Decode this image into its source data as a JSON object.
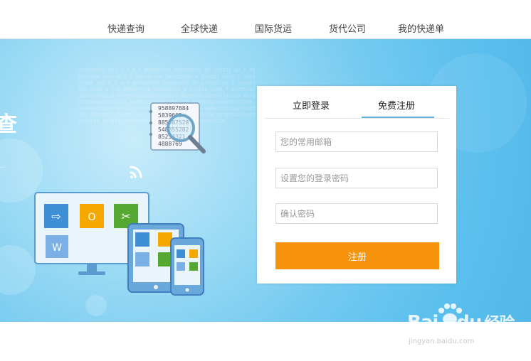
{
  "nav": {
    "items": [
      {
        "label": "快递查询"
      },
      {
        "label": "全球快递"
      },
      {
        "label": "国际货运"
      },
      {
        "label": "货代公司"
      },
      {
        "label": "我的快递单"
      }
    ]
  },
  "hero": {
    "title_fragment": "查",
    "subtitle_fragment": "..",
    "background_numbers": "958897884 583 6 5 8 9 885987528 548855282 85 233321 48 1 958897884 5839 8 7 5 885987528 548855282 8 233321 4888 7 958897884 583 6 5 8 9 885987528 548855282 85 233321 48 1 958897884 5839 8 7 5 885987528 548855282 8 233321 4888 7 98765432109876543210 98765432109876543210 98765432109876543210 98765432109876543210 98765432109876543210 98765432109876543210 98765432109876543210 98765432109876543210 98765432109876543210 98765432109876543210 98765432109876543210 98765432109876543210 98765432109876543210 98765432109876543210",
    "paper_lines": [
      "958897884",
      "5839605",
      "885987528",
      "548855282",
      "85233321",
      "4888769"
    ]
  },
  "form": {
    "tab_login": "立即登录",
    "tab_register": "免费注册",
    "email_placeholder": "您的常用邮箱",
    "password_placeholder": "设置您的登录密码",
    "confirm_placeholder": "确认密码",
    "submit_label": "注册"
  },
  "watermark": {
    "brand": "Bai",
    "brand2": "du",
    "brand_cn": "经验",
    "url": "jingyan.baidu.com"
  },
  "colors": {
    "accent_orange": "#f7920c",
    "tab_active": "#5fb4e0",
    "hero_blue": "#5bbfee"
  }
}
